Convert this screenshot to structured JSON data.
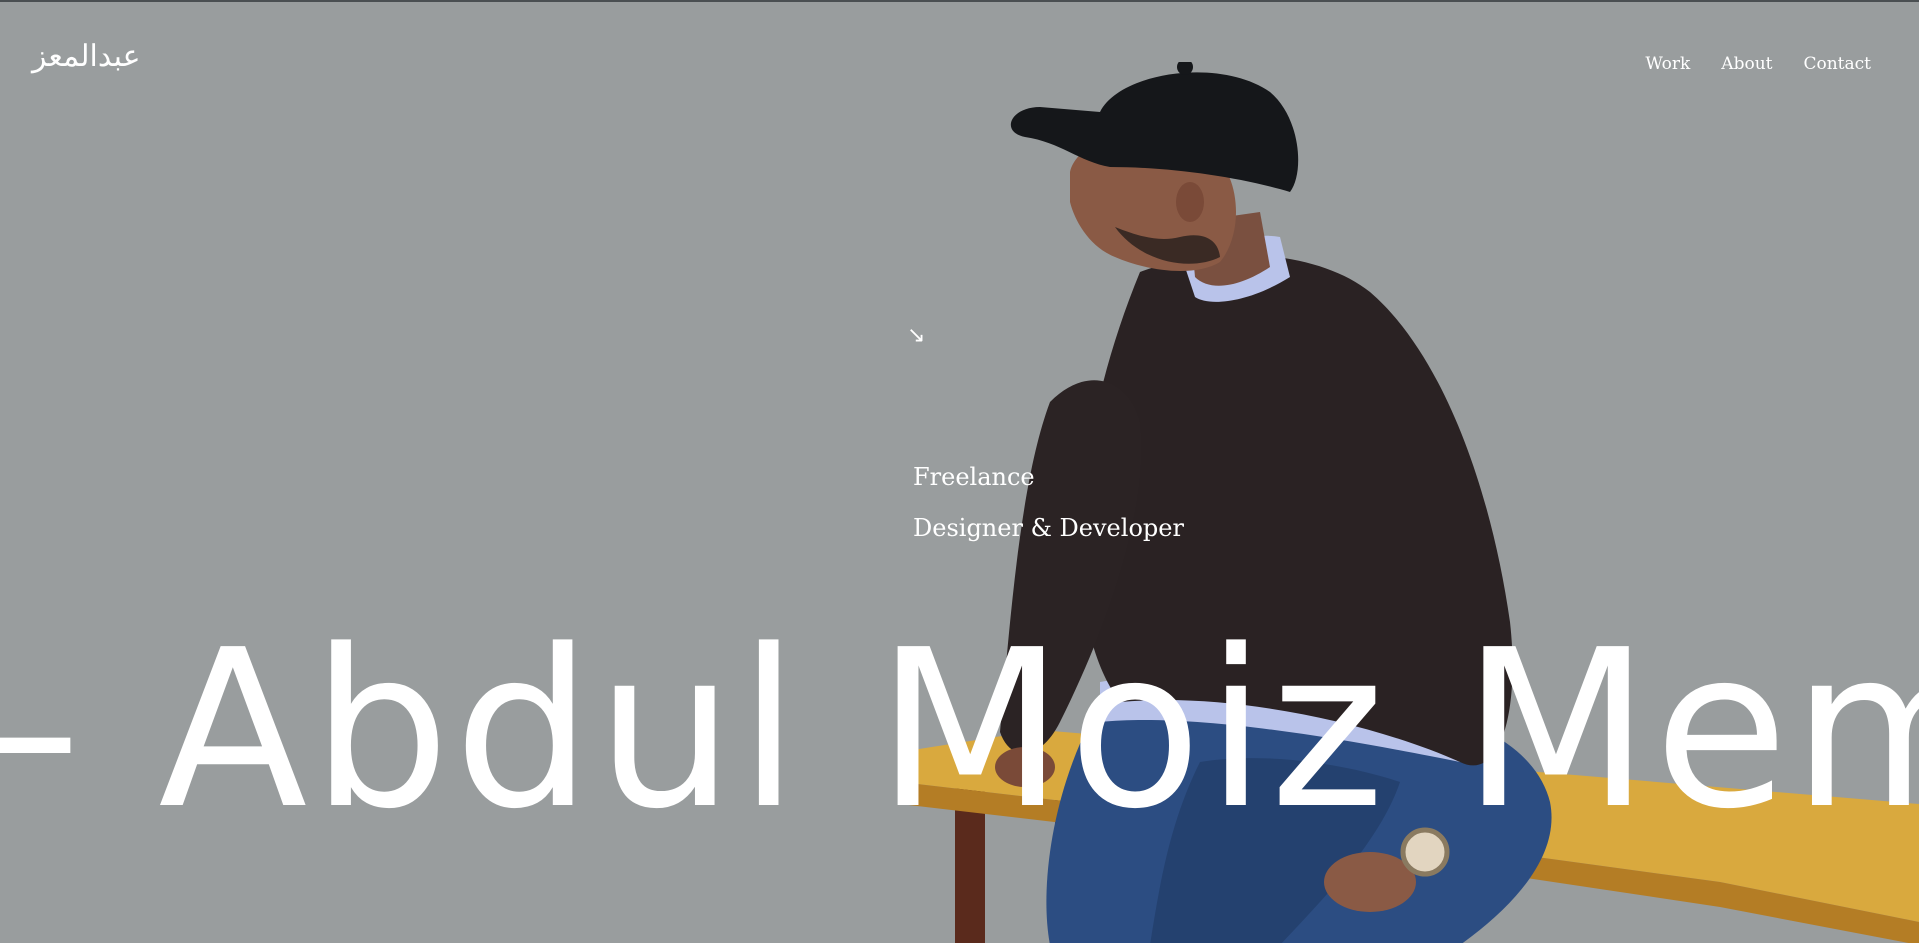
{
  "header": {
    "logo_text": "عبدالمعز",
    "nav": [
      {
        "label": "Work"
      },
      {
        "label": "About"
      },
      {
        "label": "Contact"
      }
    ]
  },
  "hero": {
    "arrow_symbol": "↘",
    "role_line1": "Freelance",
    "role_line2": "Designer & Developer",
    "marquee_text": "– Abdul Moiz Memon"
  },
  "colors": {
    "background": "#999d9e",
    "text": "#ffffff",
    "cap": "#15171a",
    "sweater": "#2a2223",
    "jeans": "#2c4d82",
    "bench": "#d9a93e"
  }
}
